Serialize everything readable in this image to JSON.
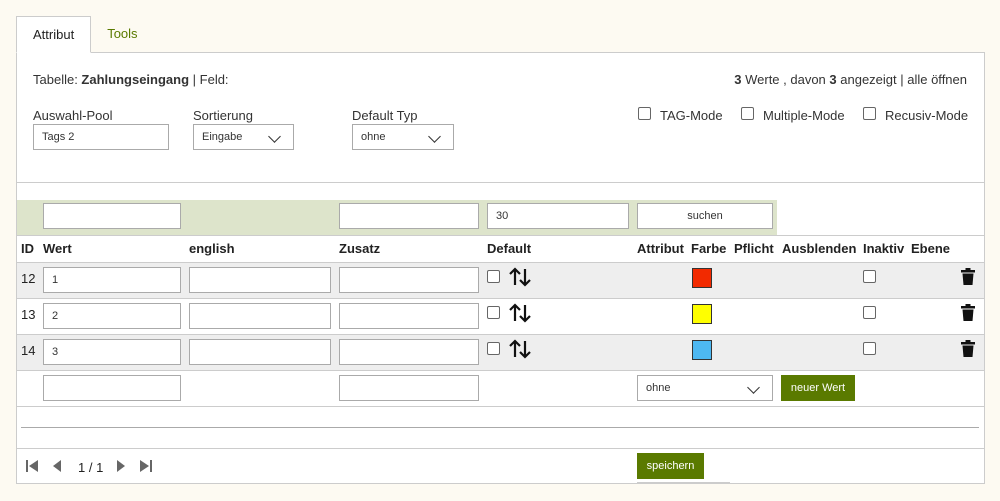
{
  "tabs": [
    {
      "label": "Attribut",
      "active": true
    },
    {
      "label": "Tools",
      "active": false
    }
  ],
  "header": {
    "table_prefix": "Tabelle: ",
    "table_name": "Zahlungseingang",
    "field_suffix": " | Feld:",
    "count_total": "3",
    "count_text_1": " Werte , davon ",
    "count_shown": "3",
    "count_text_2": " angezeigt | alle öffnen"
  },
  "settings": {
    "pool_label": "Auswahl-Pool",
    "pool_value": "Tags 2",
    "sort_label": "Sortierung",
    "sort_value": "Eingabe",
    "type_label": "Default Typ",
    "type_value": "ohne",
    "tag_mode": "TAG-Mode",
    "multiple_mode": "Multiple-Mode",
    "recursive_mode": "Recusiv-Mode"
  },
  "filter": {
    "third_value": "30",
    "search_label": "suchen"
  },
  "columns": [
    "ID",
    "Wert",
    "english",
    "Zusatz",
    "Default",
    "Attribut",
    "Farbe",
    "Pflicht",
    "Ausblenden",
    "Inaktiv",
    "Ebene"
  ],
  "rows": [
    {
      "id": "12",
      "wert": "1",
      "color": "#f22a00"
    },
    {
      "id": "13",
      "wert": "2",
      "color": "#ffff00"
    },
    {
      "id": "14",
      "wert": "3",
      "color": "#4db8f2"
    }
  ],
  "new_row": {
    "attribut_value": "ohne",
    "button_label": "neuer Wert"
  },
  "footer": {
    "page_info": "1 / 1",
    "save_label": "speichern"
  },
  "colors": {
    "accent": "#5a7a00",
    "filter_bg": "#dde4cb"
  }
}
